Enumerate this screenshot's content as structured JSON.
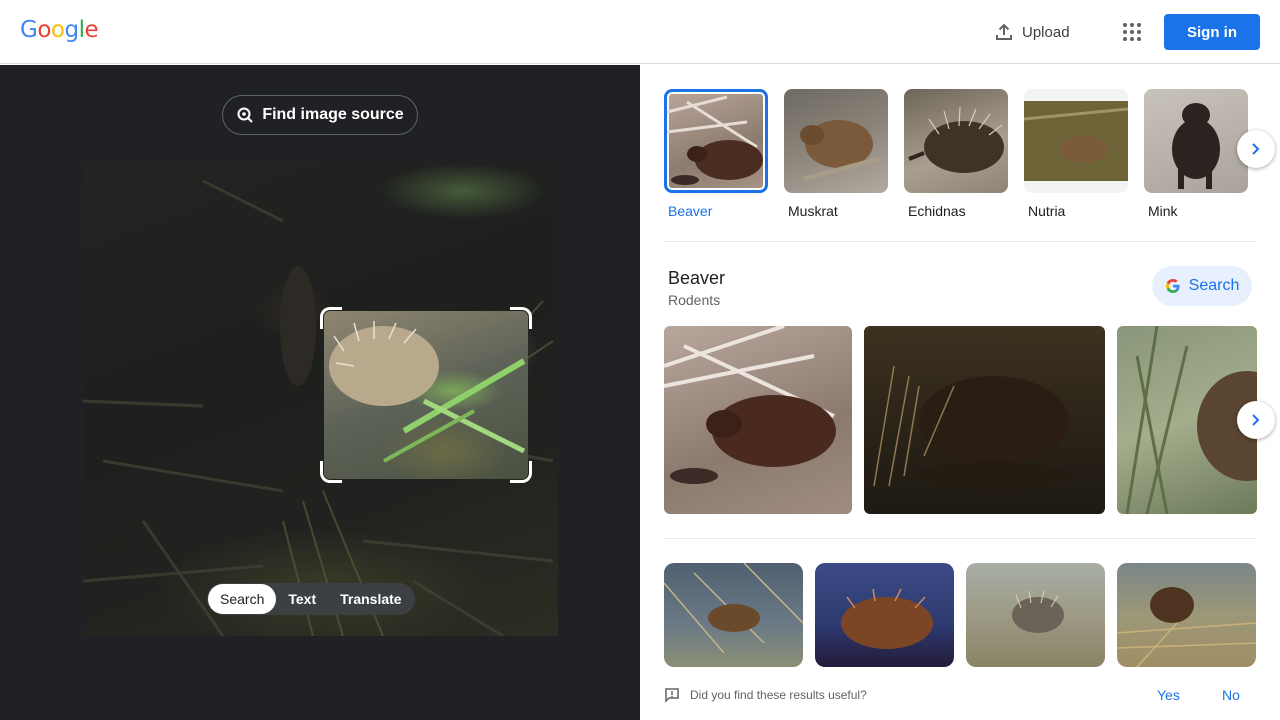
{
  "header": {
    "logo_letters": [
      {
        "ch": "G",
        "color": "#4285f4"
      },
      {
        "ch": "o",
        "color": "#ea4335"
      },
      {
        "ch": "o",
        "color": "#fbbc05"
      },
      {
        "ch": "g",
        "color": "#4285f4"
      },
      {
        "ch": "l",
        "color": "#34a853"
      },
      {
        "ch": "e",
        "color": "#ea4335"
      }
    ],
    "upload_label": "Upload",
    "signin_label": "Sign in"
  },
  "left_panel": {
    "find_source_label": "Find image source",
    "modes": [
      {
        "label": "Search",
        "active": true
      },
      {
        "label": "Text",
        "active": false
      },
      {
        "label": "Translate",
        "active": false
      }
    ]
  },
  "entities": [
    {
      "label": "Beaver",
      "selected": true
    },
    {
      "label": "Muskrat",
      "selected": false
    },
    {
      "label": "Echidnas",
      "selected": false
    },
    {
      "label": "Nutria",
      "selected": false
    },
    {
      "label": "Mink",
      "selected": false
    }
  ],
  "entity_card": {
    "title": "Beaver",
    "subtitle": "Rodents",
    "search_label": "Search"
  },
  "feedback": {
    "question": "Did you find these results useful?",
    "yes_label": "Yes",
    "no_label": "No"
  },
  "colors": {
    "accent": "#1a73e8",
    "left_bg": "#202124"
  }
}
